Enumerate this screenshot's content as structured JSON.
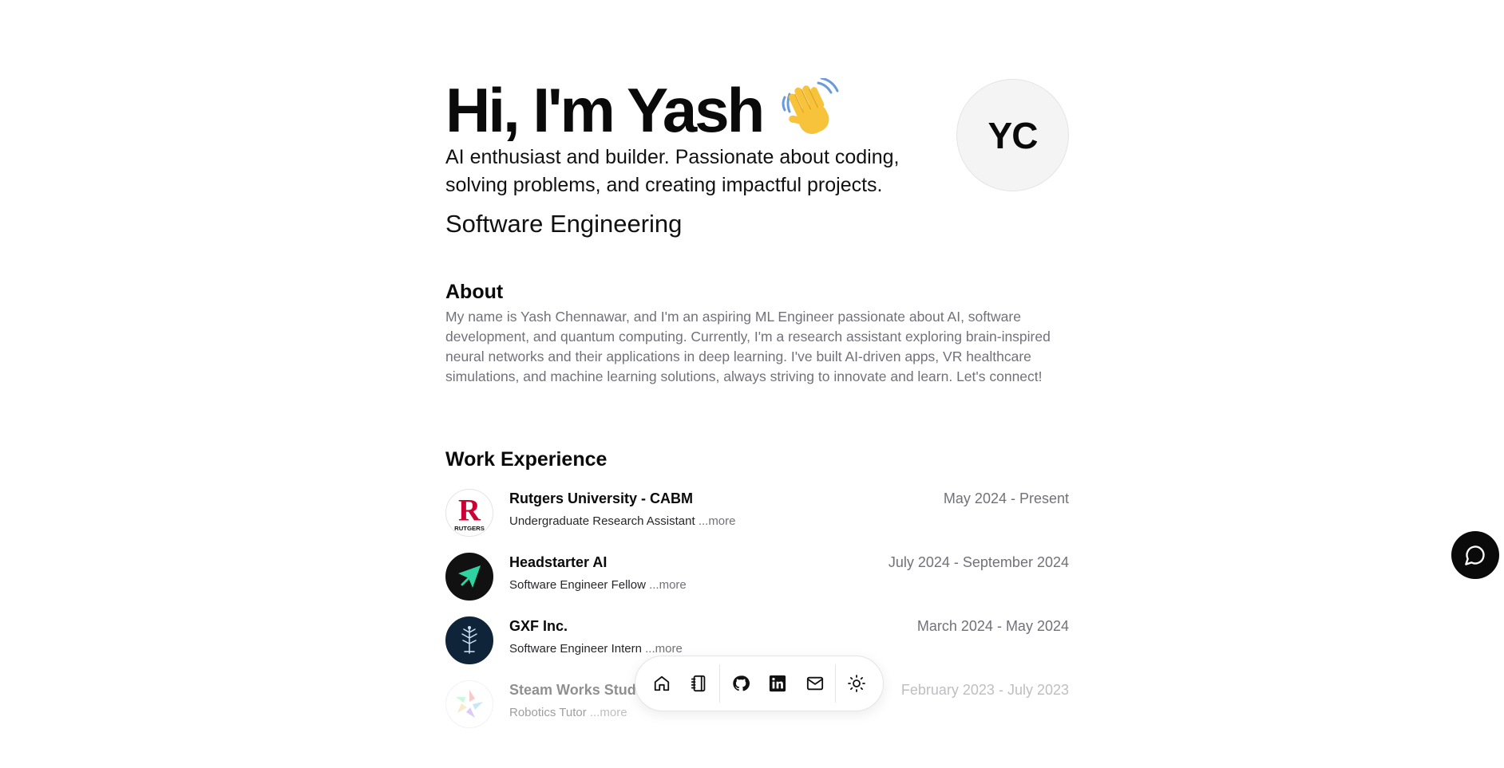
{
  "hero": {
    "title": "Hi, I'm Yash",
    "wave_emoji": "👋",
    "subtitle": "AI enthusiast and builder. Passionate about coding, solving problems, and creating impactful projects.",
    "role": "Software Engineering",
    "avatar_initials": "YC"
  },
  "about": {
    "heading": "About",
    "text": "My name is Yash Chennawar, and I'm an aspiring ML Engineer passionate about AI, software development, and quantum computing. Currently, I'm a research assistant exploring brain-inspired neural networks and their applications in deep learning. I've built AI-driven apps, VR healthcare simulations, and machine learning solutions, always striving to innovate and learn. Let's connect!"
  },
  "work": {
    "heading": "Work Experience",
    "more_label": "...more",
    "items": [
      {
        "company": "Rutgers University - CABM",
        "role": "Undergraduate Research Assistant",
        "dates": "May 2024 - Present",
        "logo": "rutgers-logo-icon"
      },
      {
        "company": "Headstarter AI",
        "role": "Software Engineer Fellow",
        "dates": "July 2024 - September 2024",
        "logo": "headstarter-logo-icon"
      },
      {
        "company": "GXF Inc.",
        "role": "Software Engineer Intern",
        "dates": "March 2024 - May 2024",
        "logo": "gxf-logo-icon"
      },
      {
        "company": "Steam Works Stud",
        "role": "Robotics Tutor",
        "dates": "February 2023 - July 2023",
        "logo": "steamworks-logo-icon"
      }
    ]
  },
  "logos": {
    "rutgers_letter": "R",
    "rutgers_text": "RUTGERS"
  },
  "dock": {
    "items": [
      "home-icon",
      "notebook-icon",
      "github-icon",
      "linkedin-icon",
      "mail-icon",
      "sun-icon"
    ]
  },
  "colors": {
    "text": "#0a0a0a",
    "muted": "#71717a",
    "rutgers_red": "#cc0033",
    "headstarter_green": "#2dd4a0"
  }
}
